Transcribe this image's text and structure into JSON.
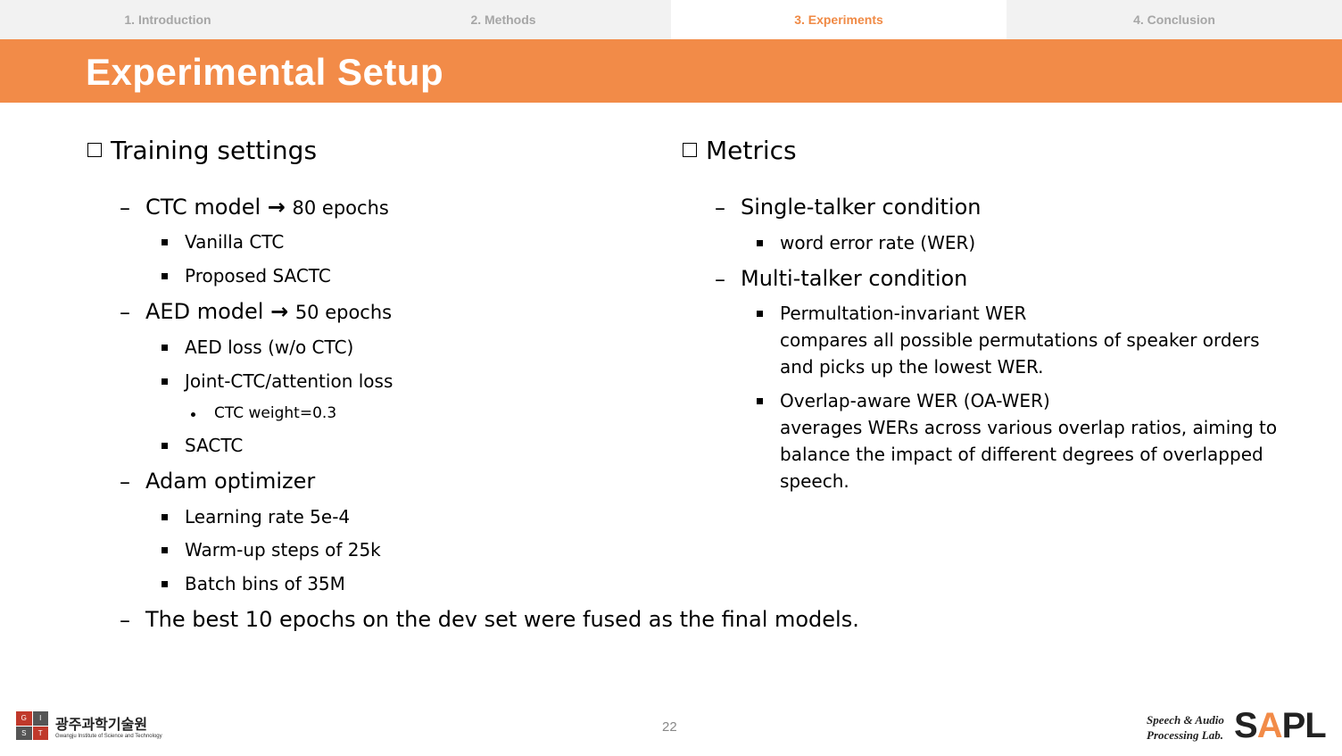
{
  "nav": {
    "tabs": [
      "1. Introduction",
      "2. Methods",
      "3. Experiments",
      "4. Conclusion"
    ],
    "active": "3. Experiments"
  },
  "title": "Experimental Setup",
  "left": {
    "heading": "Training settings",
    "ctc": {
      "label": "CTC model",
      "arrow": "→",
      "value": "80 epochs",
      "items": [
        "Vanilla CTC",
        "Proposed SACTC"
      ]
    },
    "aed": {
      "label": "AED model",
      "arrow": "→",
      "value": "50 epochs",
      "items": [
        "AED loss (w/o CTC)",
        "Joint-CTC/attention loss",
        "SACTC"
      ],
      "sub": "CTC weight=0.3"
    },
    "adam": {
      "label": "Adam optimizer",
      "items": [
        "Learning rate 5e-4",
        "Warm-up steps of 25k",
        "Batch bins of 35M"
      ]
    },
    "final": "The best 10 epochs on the dev set were fused as the final models."
  },
  "right": {
    "heading": "Metrics",
    "single": {
      "label": "Single-talker condition",
      "item": "word error rate (WER)"
    },
    "multi": {
      "label": "Multi-talker condition",
      "pi": {
        "title": "Permultation-invariant WER",
        "lines": [
          "compares all possible permutations of speaker orders",
          "and picks up the lowest WER."
        ]
      },
      "oa": {
        "title": "Overlap-aware WER (OA-WER)",
        "lines": [
          "averages WERs across various overlap ratios, aiming to",
          "balance the impact of different degrees of overlapped",
          "speech."
        ]
      }
    }
  },
  "footer": {
    "page": "22",
    "gist_korean": "광주과학기술원",
    "gist_english": "Gwangju Institute of Science and Technology",
    "gist_letters": [
      "G",
      "I",
      "S",
      "T"
    ],
    "lab_line1": "Speech & Audio",
    "lab_line2": "Processing Lab.",
    "lab_logo": [
      "S",
      "A",
      "PL"
    ]
  },
  "colors": {
    "accent": "#f28b48",
    "tab_inactive": "#a6a6a6",
    "tab_active": "#f08a45"
  }
}
